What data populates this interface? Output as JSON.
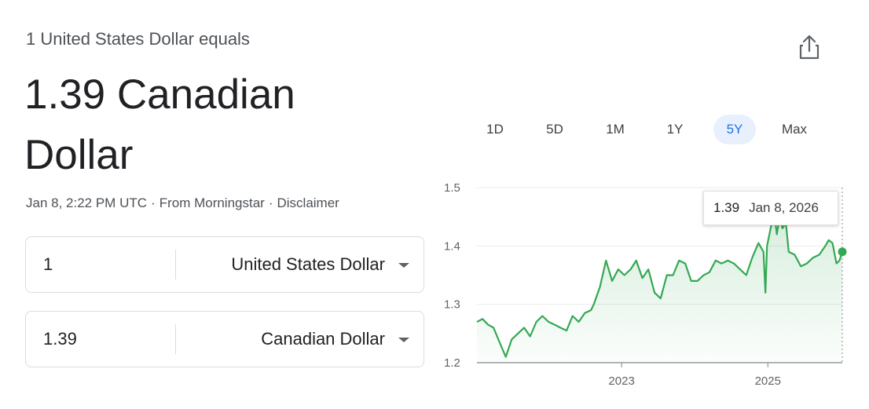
{
  "header": {
    "pre_title": "1 United States Dollar equals",
    "value": "1.39 Canadian Dollar",
    "timestamp": "Jan 8, 2:22 PM UTC",
    "separator": "·",
    "source": "From Morningstar",
    "disclaimer": "Disclaimer"
  },
  "converter": {
    "from": {
      "amount": "1",
      "currency": "United States Dollar"
    },
    "to": {
      "amount": "1.39",
      "currency": "Canadian Dollar"
    }
  },
  "share_icon": "share-icon",
  "ranges": {
    "items": [
      "1D",
      "5D",
      "1M",
      "1Y",
      "5Y",
      "Max"
    ],
    "active": "5Y"
  },
  "tooltip": {
    "value": "1.39",
    "date": "Jan 8, 2026"
  },
  "colors": {
    "line": "#34a853",
    "active_range_bg": "#e8f0fe",
    "active_range_text": "#1a73e8",
    "text": "#202124",
    "secondary_text": "#4d5156"
  },
  "chart_data": {
    "type": "area",
    "ylim": [
      1.2,
      1.5
    ],
    "yticks": [
      "1.5",
      "1.4",
      "1.3",
      "1.2"
    ],
    "xlim": [
      "2021-01-08",
      "2026-01-08"
    ],
    "xticks": [
      {
        "label": "2023",
        "date": "2023-01-01"
      },
      {
        "label": "2025",
        "date": "2025-01-01"
      }
    ],
    "series": [
      {
        "points": [
          [
            "2021-01-08",
            1.27
          ],
          [
            "2021-02-05",
            1.275
          ],
          [
            "2021-03-05",
            1.265
          ],
          [
            "2021-04-01",
            1.26
          ],
          [
            "2021-05-01",
            1.235
          ],
          [
            "2021-06-01",
            1.21
          ],
          [
            "2021-07-01",
            1.24
          ],
          [
            "2021-08-01",
            1.25
          ],
          [
            "2021-09-01",
            1.26
          ],
          [
            "2021-10-01",
            1.245
          ],
          [
            "2021-11-01",
            1.27
          ],
          [
            "2021-12-01",
            1.28
          ],
          [
            "2022-01-01",
            1.27
          ],
          [
            "2022-02-01",
            1.265
          ],
          [
            "2022-03-01",
            1.26
          ],
          [
            "2022-04-01",
            1.255
          ],
          [
            "2022-05-01",
            1.28
          ],
          [
            "2022-06-01",
            1.27
          ],
          [
            "2022-07-01",
            1.285
          ],
          [
            "2022-08-01",
            1.29
          ],
          [
            "2022-08-15",
            1.3
          ],
          [
            "2022-09-15",
            1.33
          ],
          [
            "2022-10-15",
            1.375
          ],
          [
            "2022-11-15",
            1.34
          ],
          [
            "2022-12-15",
            1.36
          ],
          [
            "2023-01-15",
            1.35
          ],
          [
            "2023-02-15",
            1.36
          ],
          [
            "2023-03-15",
            1.375
          ],
          [
            "2023-04-15",
            1.345
          ],
          [
            "2023-05-15",
            1.36
          ],
          [
            "2023-06-15",
            1.32
          ],
          [
            "2023-07-15",
            1.31
          ],
          [
            "2023-08-15",
            1.35
          ],
          [
            "2023-09-15",
            1.35
          ],
          [
            "2023-10-15",
            1.375
          ],
          [
            "2023-11-15",
            1.37
          ],
          [
            "2023-12-15",
            1.34
          ],
          [
            "2024-01-15",
            1.34
          ],
          [
            "2024-02-15",
            1.35
          ],
          [
            "2024-03-15",
            1.355
          ],
          [
            "2024-04-15",
            1.375
          ],
          [
            "2024-05-15",
            1.37
          ],
          [
            "2024-06-15",
            1.375
          ],
          [
            "2024-07-15",
            1.37
          ],
          [
            "2024-08-15",
            1.36
          ],
          [
            "2024-09-15",
            1.35
          ],
          [
            "2024-10-15",
            1.38
          ],
          [
            "2024-11-15",
            1.405
          ],
          [
            "2024-12-10",
            1.39
          ],
          [
            "2024-12-20",
            1.32
          ],
          [
            "2024-12-28",
            1.4
          ],
          [
            "2025-01-15",
            1.43
          ],
          [
            "2025-02-01",
            1.46
          ],
          [
            "2025-02-15",
            1.42
          ],
          [
            "2025-03-01",
            1.45
          ],
          [
            "2025-03-15",
            1.43
          ],
          [
            "2025-04-01",
            1.44
          ],
          [
            "2025-04-15",
            1.39
          ],
          [
            "2025-05-15",
            1.385
          ],
          [
            "2025-06-15",
            1.365
          ],
          [
            "2025-07-15",
            1.37
          ],
          [
            "2025-08-15",
            1.38
          ],
          [
            "2025-09-15",
            1.385
          ],
          [
            "2025-10-15",
            1.4
          ],
          [
            "2025-11-01",
            1.41
          ],
          [
            "2025-11-20",
            1.405
          ],
          [
            "2025-12-10",
            1.37
          ],
          [
            "2025-12-25",
            1.375
          ],
          [
            "2026-01-08",
            1.39
          ]
        ]
      }
    ],
    "highlight": {
      "date": "2026-01-08",
      "value": 1.39
    }
  }
}
